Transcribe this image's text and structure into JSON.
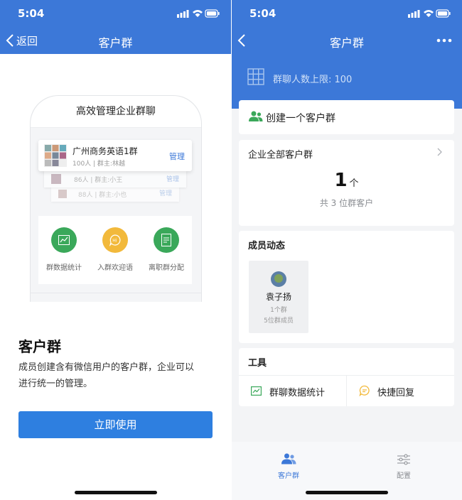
{
  "status": {
    "time": "5:04"
  },
  "left": {
    "nav": {
      "back_label": "返回",
      "title": "客户群"
    },
    "illustration": {
      "heading": "高效管理企业群聊",
      "group1": {
        "name": "广州商务英语1群",
        "meta": "100人 | 群主:林越",
        "action": "管理"
      },
      "group2": {
        "meta": "86人 | 群主:小王",
        "action": "管理"
      },
      "group3": {
        "meta": "88人 | 群主:小也",
        "action": "管理"
      },
      "features": [
        {
          "label": "群数据统计",
          "icon": "chart-icon"
        },
        {
          "label": "入群欢迎语",
          "icon": "hi-bubble-icon"
        },
        {
          "label": "离职群分配",
          "icon": "document-icon"
        }
      ]
    },
    "intro": {
      "title": "客户群",
      "desc_line1": "成员创建含有微信用户的客户群，企业可以",
      "desc_line2": "进行统一的管理。"
    },
    "cta_label": "立即使用"
  },
  "right": {
    "nav": {
      "title": "客户群"
    },
    "limit_label": "群聊人数上限: 100",
    "create_label": "创建一个客户群",
    "all_groups": {
      "title": "企业全部客户群",
      "count": "1",
      "unit": "个",
      "sub": "共 3 位群客户"
    },
    "member_activity": {
      "title": "成员动态",
      "member": {
        "name": "袁子扬",
        "groups": "1个群",
        "members": "5位群成员"
      }
    },
    "tools": {
      "title": "工具",
      "item1": "群聊数据统计",
      "item2": "快捷回复"
    },
    "tabs": {
      "tab1": "客户群",
      "tab2": "配置"
    }
  },
  "colors": {
    "primary_blue": "#3c78d8",
    "cta_blue": "#2e7fe0",
    "green": "#3aa85a",
    "orange": "#f2b93b"
  }
}
